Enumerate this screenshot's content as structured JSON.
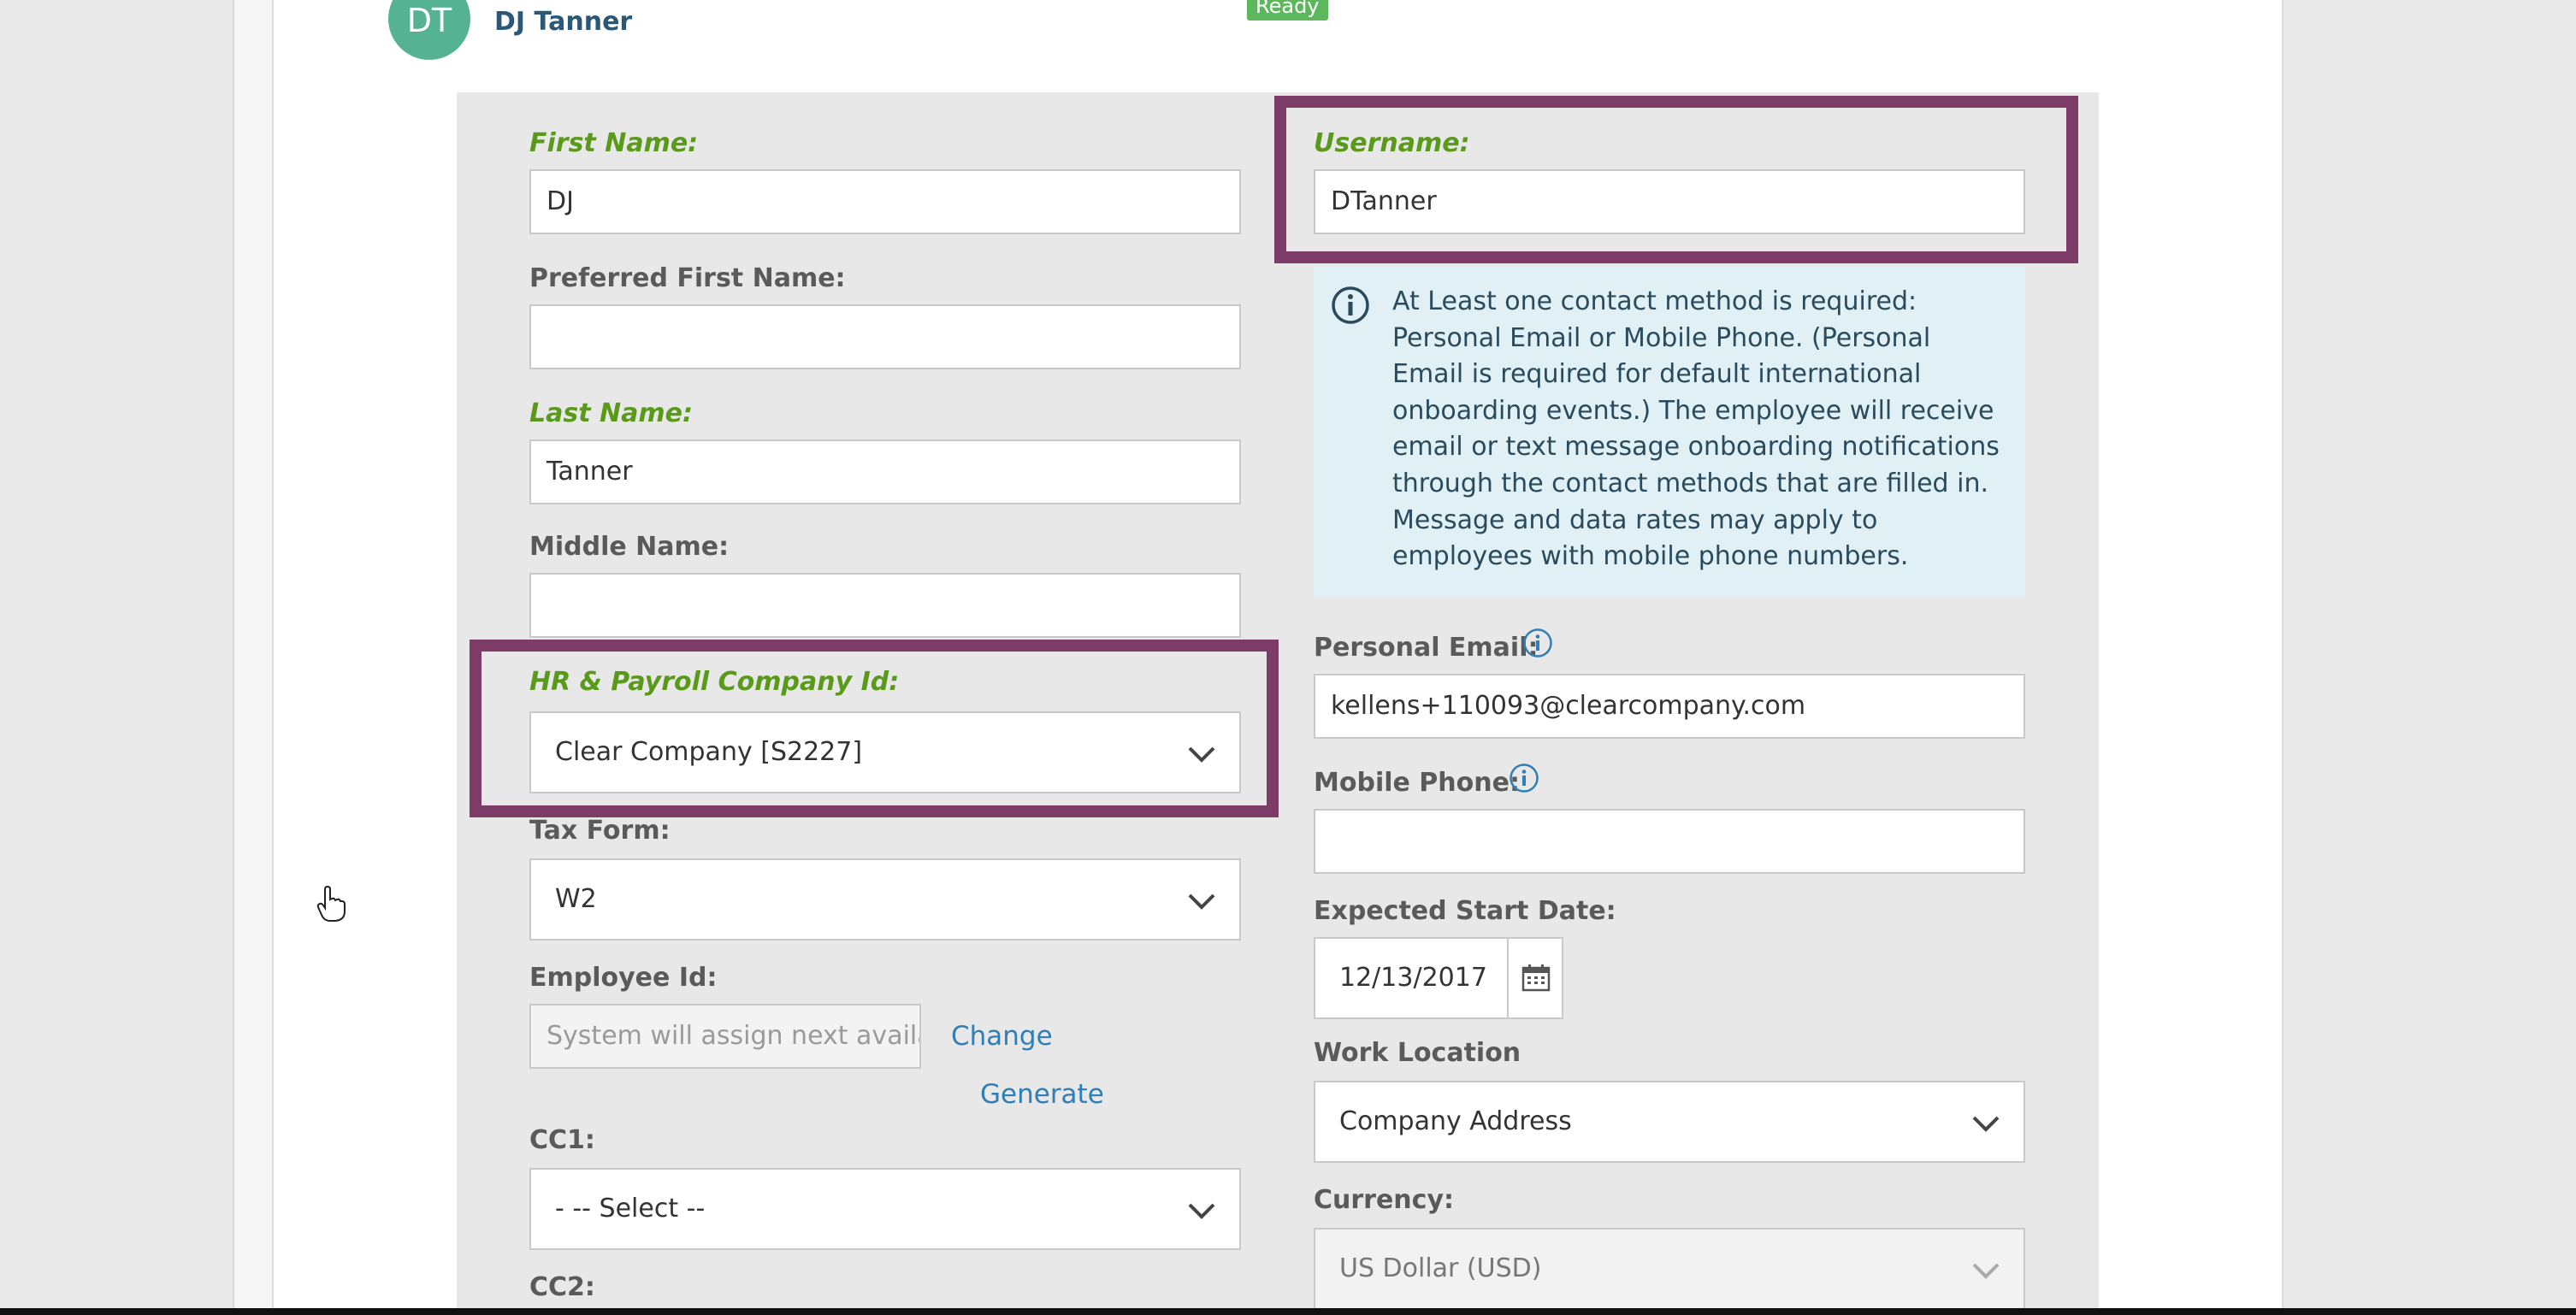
{
  "header": {
    "avatar_initials": "DT",
    "name": "DJ Tanner",
    "status_badge": "Ready"
  },
  "left": {
    "first_name": {
      "label": "First Name:",
      "value": "DJ"
    },
    "preferred_first_name": {
      "label": "Preferred First Name:",
      "value": ""
    },
    "last_name": {
      "label": "Last Name:",
      "value": "Tanner"
    },
    "middle_name": {
      "label": "Middle Name:",
      "value": ""
    },
    "company_id": {
      "label": "HR & Payroll Company Id:",
      "value": "Clear Company [S2227]"
    },
    "tax_form": {
      "label": "Tax Form:",
      "value": "W2"
    },
    "employee_id": {
      "label": "Employee Id:",
      "placeholder": "System will assign next availab",
      "change_link": "Change",
      "generate_link": "Generate"
    },
    "cc1": {
      "label": "CC1:",
      "value": "- -- Select --"
    },
    "cc2": {
      "label": "CC2:"
    }
  },
  "right": {
    "username": {
      "label": "Username:",
      "value": "DTanner"
    },
    "info_text": "At Least one contact method is required: Personal Email or Mobile Phone. (Personal Email is required for default international onboarding events.) The employee will receive email or text message onboarding notifications through the contact methods that are filled in. Message and data rates may apply to employees with mobile phone numbers.",
    "personal_email": {
      "label": "Personal Email:",
      "value": "kellens+110093@clearcompany.com"
    },
    "mobile_phone": {
      "label": "Mobile Phone:",
      "value": ""
    },
    "start_date": {
      "label": "Expected Start Date:",
      "value": "12/13/2017"
    },
    "work_location": {
      "label": "Work Location",
      "value": "Company Address"
    },
    "currency": {
      "label": "Currency:",
      "value": "US Dollar (USD)"
    }
  },
  "colors": {
    "required_label": "#5a9a1a",
    "highlight_border": "#7d3b67",
    "link": "#2f7fb5",
    "avatar": "#55b394",
    "badge": "#5cb85c",
    "info_bg": "#e1f0f4"
  },
  "icons": [
    "info-icon",
    "help-icon",
    "calendar-icon",
    "chevron-down-icon",
    "hand-cursor-icon"
  ]
}
